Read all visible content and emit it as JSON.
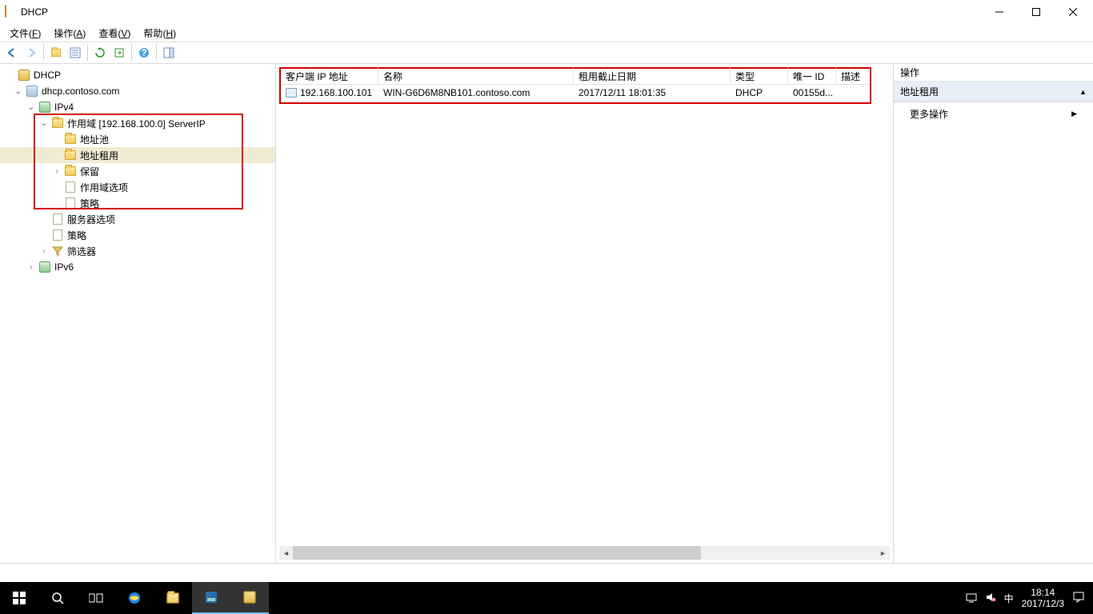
{
  "titlebar": {
    "title": "DHCP"
  },
  "menubar": {
    "file": "文件",
    "file_key": "F",
    "action": "操作",
    "action_key": "A",
    "view": "查看",
    "view_key": "V",
    "help": "帮助",
    "help_key": "H"
  },
  "tree": {
    "root": "DHCP",
    "server": "dhcp.contoso.com",
    "ipv4": "IPv4",
    "scope": "作用域 [192.168.100.0] ServerIP",
    "address_pool": "地址池",
    "address_leases": "地址租用",
    "reservations": "保留",
    "scope_options": "作用域选项",
    "policies": "策略",
    "server_options": "服务器选项",
    "policies2": "策略",
    "filters": "筛选器",
    "ipv6": "IPv6"
  },
  "list": {
    "columns": {
      "client_ip": "客户端 IP 地址",
      "name": "名称",
      "lease_expiry": "租用截止日期",
      "type": "类型",
      "unique_id": "唯一 ID",
      "description": "描述"
    },
    "rows": [
      {
        "client_ip": "192.168.100.101",
        "name": "WIN-G6D6M8NB101.contoso.com",
        "lease_expiry": "2017/12/11 18:01:35",
        "type": "DHCP",
        "unique_id": "00155d...",
        "description": ""
      }
    ]
  },
  "actions": {
    "header": "操作",
    "section": "地址租用",
    "more": "更多操作"
  },
  "taskbar": {
    "time": "18:14",
    "date": "2017/12/3",
    "ime": "中"
  }
}
